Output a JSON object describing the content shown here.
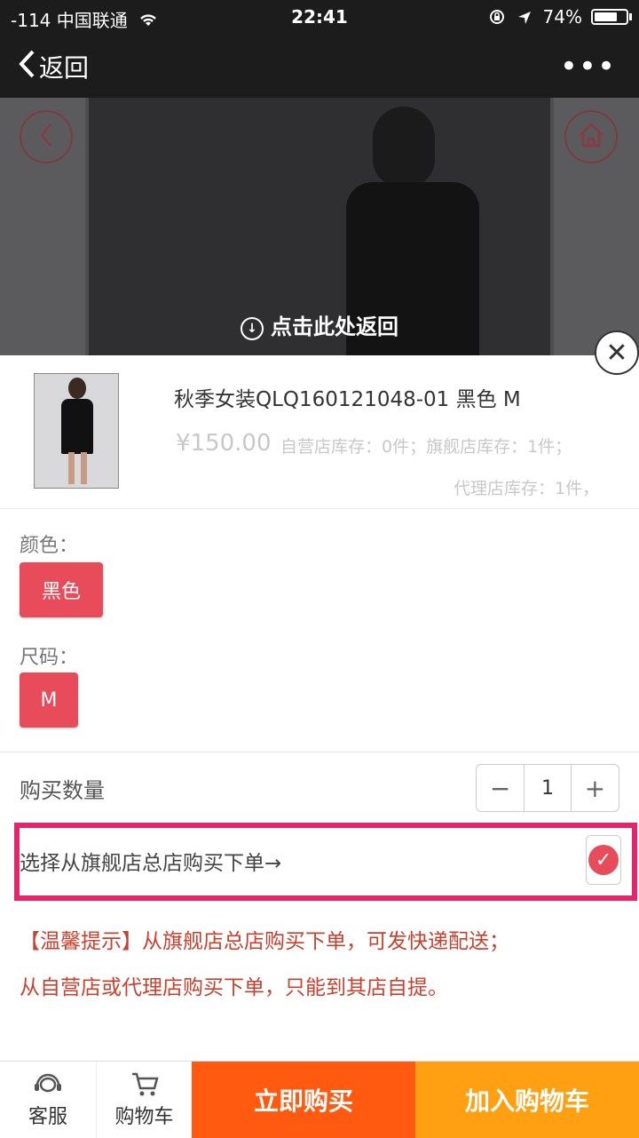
{
  "status_bar": {
    "carrier": "-114 中国联通",
    "time": "22:41",
    "battery": "74%",
    "battery_level": 0.74
  },
  "nav": {
    "back_label": "返回",
    "more_icon": "ellipsis-icon"
  },
  "preview": {
    "return_hint": "点击此处返回"
  },
  "product": {
    "name": "秋季女装QLQ160121048-01 黑色 M",
    "price": "¥150.00",
    "stock_self": "自营店库存：0件；",
    "stock_flagship": "旗舰店库存：1件；",
    "stock_agent": "代理店库存：1件，"
  },
  "options": {
    "color_label": "颜色：",
    "color_value": "黑色",
    "size_label": "尺码：",
    "size_value": "M"
  },
  "quantity": {
    "label": "购买数量",
    "minus": "−",
    "value": "1",
    "plus": "+"
  },
  "flagship_order": {
    "label": "选择从旗舰店总店购买下单→",
    "checked": true
  },
  "tips": {
    "line1": "【温馨提示】从旗舰店总店购买下单，可发快递配送；",
    "line2": "从自营店或代理店购买下单，只能到其店自提。"
  },
  "bottom_bar": {
    "service_label": "客服",
    "cart_label": "购物车",
    "buy_now_label": "立即购买",
    "add_cart_label": "加入购物车"
  },
  "colors": {
    "accent_red": "#e84c5a",
    "highlight_border": "#e5256b",
    "buy_now": "#ff5a0f",
    "add_cart": "#ff9f12",
    "tip_text": "#c8412e"
  }
}
